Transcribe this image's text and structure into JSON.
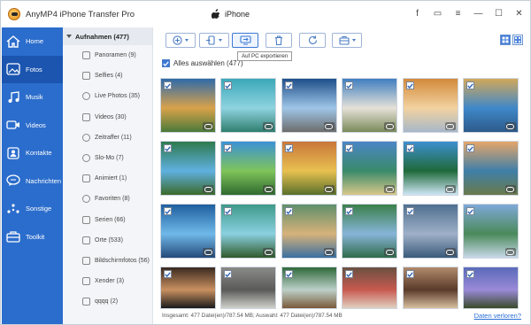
{
  "app": {
    "title": "AnyMP4 iPhone Transfer Pro",
    "device": "iPhone"
  },
  "window_controls": [
    {
      "name": "facebook-icon",
      "glyph": "f"
    },
    {
      "name": "feedback-icon",
      "glyph": "▭"
    },
    {
      "name": "menu-icon",
      "glyph": "≡"
    },
    {
      "name": "minimize-icon",
      "glyph": "—"
    },
    {
      "name": "maximize-icon",
      "glyph": "☐"
    },
    {
      "name": "close-icon",
      "glyph": "✕"
    }
  ],
  "nav": [
    {
      "label": "Home",
      "icon": "home-icon"
    },
    {
      "label": "Fotos",
      "icon": "photos-icon",
      "active": true
    },
    {
      "label": "Musik",
      "icon": "music-icon"
    },
    {
      "label": "Videos",
      "icon": "video-icon"
    },
    {
      "label": "Kontakte",
      "icon": "contacts-icon"
    },
    {
      "label": "Nachrichten",
      "icon": "messages-icon"
    },
    {
      "label": "Sonstige",
      "icon": "other-icon"
    },
    {
      "label": "Toolkit",
      "icon": "toolkit-icon"
    }
  ],
  "sublist": {
    "header": "Aufnahmen (477)",
    "items": [
      {
        "label": "Panoramen (9)"
      },
      {
        "label": "Selfies (4)"
      },
      {
        "label": "Live Photos (35)"
      },
      {
        "label": "Videos (30)"
      },
      {
        "label": "Zeitraffer (11)"
      },
      {
        "label": "Slo-Mo (7)"
      },
      {
        "label": "Animiert (1)"
      },
      {
        "label": "Favoriten (8)"
      },
      {
        "label": "Serien (66)"
      },
      {
        "label": "Orte (533)"
      },
      {
        "label": "Bildschirmfotos (56)"
      },
      {
        "label": "Xender (3)"
      },
      {
        "label": "qqqq (2)"
      }
    ]
  },
  "toolbar": {
    "tooltip": "Auf PC exportieren"
  },
  "select_all": {
    "label": "Alles auswählen (477)",
    "checked": true
  },
  "thumbnails": [
    [
      "#2f6aa8",
      "#d9a24a",
      "#4a7a3a"
    ],
    [
      "#3aa8b8",
      "#8fd3e0",
      "#2f7f6f"
    ],
    [
      "#1e4f8a",
      "#9fc6e8",
      "#6c6c6c"
    ],
    [
      "#3f7fc0",
      "#e6e1d8",
      "#7a8a5a"
    ],
    [
      "#d38a3a",
      "#f2d2a0",
      "#a7b8c9"
    ],
    [
      "#d2a85a",
      "#3f88c9",
      "#2d5a8a"
    ],
    [
      "#2e7a4e",
      "#5fb0e0",
      "#3b6a2a"
    ],
    [
      "#3b92d6",
      "#7fc45a",
      "#2f6a2f"
    ],
    [
      "#c9773a",
      "#e8c050",
      "#5a6f2a"
    ],
    [
      "#4a86c6",
      "#3a8a6a",
      "#d8c88a"
    ],
    [
      "#3d8fd0",
      "#1f6a3a",
      "#cfe6f5"
    ],
    [
      "#e5a66a",
      "#3f7fa8",
      "#6a7a4a"
    ],
    [
      "#1f5f9f",
      "#6fb8e8",
      "#244a7a"
    ],
    [
      "#3e9a8a",
      "#8ad0e0",
      "#2f5a2a"
    ],
    [
      "#5f8f6a",
      "#d7b27a",
      "#3a6fa0"
    ],
    [
      "#3a7f4a",
      "#87b5d8",
      "#2f6a4a"
    ],
    [
      "#4f6f8f",
      "#9fb0c8",
      "#3a5a7a"
    ],
    [
      "#7fa8d8",
      "#4a8a5a",
      "#c8d8e8"
    ],
    [
      "#3a2a20",
      "#c89060",
      "#1a1a1a"
    ],
    [
      "#8a8a88",
      "#5a5a58",
      "#d0d0cc"
    ],
    [
      "#2f6a3a",
      "#bcd0c8",
      "#7a5a3a"
    ],
    [
      "#6a5040",
      "#c85a50",
      "#e0d0c0"
    ],
    [
      "#b08a6a",
      "#5a3a2a",
      "#d8c0a0"
    ],
    [
      "#5a6ab8",
      "#9a8ad8",
      "#3a4a2a"
    ]
  ],
  "status": {
    "text": "Insgesamt: 477 Datei(en)/787.54 MB; Auswahl: 477 Datei(en)/787.54 MB",
    "lost_link": "Daten verloren?"
  }
}
